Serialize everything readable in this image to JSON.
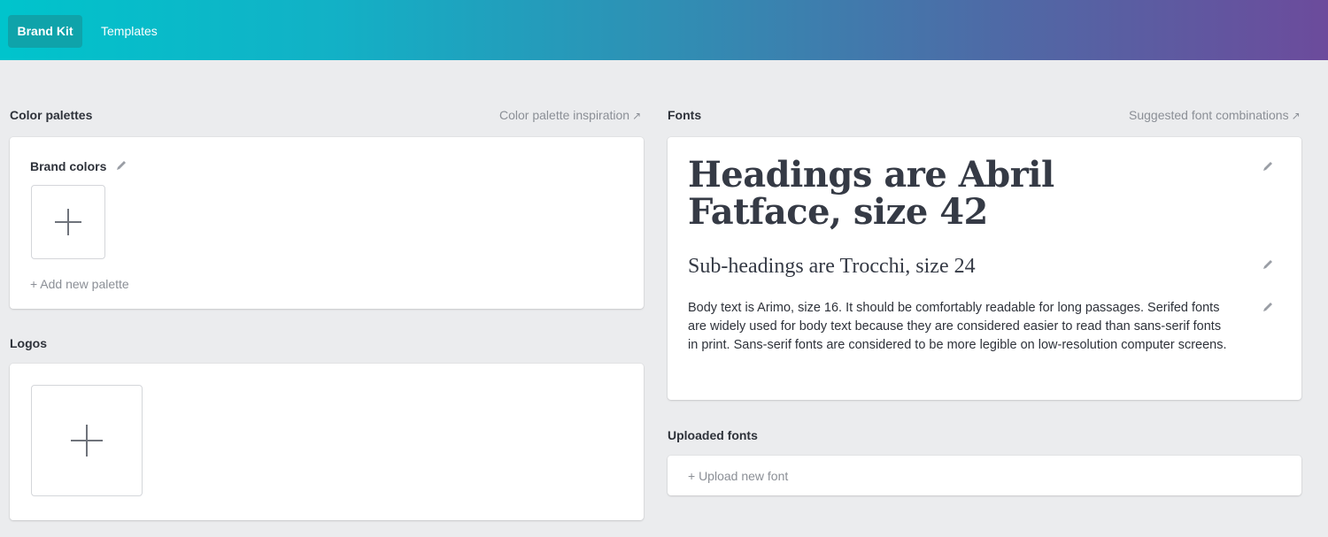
{
  "nav": {
    "brand_kit": "Brand Kit",
    "templates": "Templates"
  },
  "colors": {
    "accent_start": "#00c4cc",
    "accent_end": "#6c4b9c"
  },
  "color_palettes": {
    "title": "Color palettes",
    "inspiration_link": "Color palette inspiration",
    "brand_colors_label": "Brand colors",
    "add_palette": "+ Add new palette"
  },
  "logos": {
    "title": "Logos"
  },
  "fonts": {
    "title": "Fonts",
    "suggested_link": "Suggested font combinations",
    "heading_sample": "Headings are Abril Fatface, size 42",
    "subheading_sample": "Sub-headings are Trocchi, size 24",
    "body_sample": "Body text is Arimo, size 16. It should be comfortably readable for long passages. Serifed fonts are widely used for body text because they are considered easier to read than sans-serif fonts in print. Sans-serif fonts are considered to be more legible on low-resolution computer screens."
  },
  "uploaded_fonts": {
    "title": "Uploaded fonts",
    "upload_link": "+ Upload new font"
  },
  "icons": {
    "edit": "pencil-icon",
    "external": "external-arrow-icon",
    "add": "plus-icon"
  }
}
